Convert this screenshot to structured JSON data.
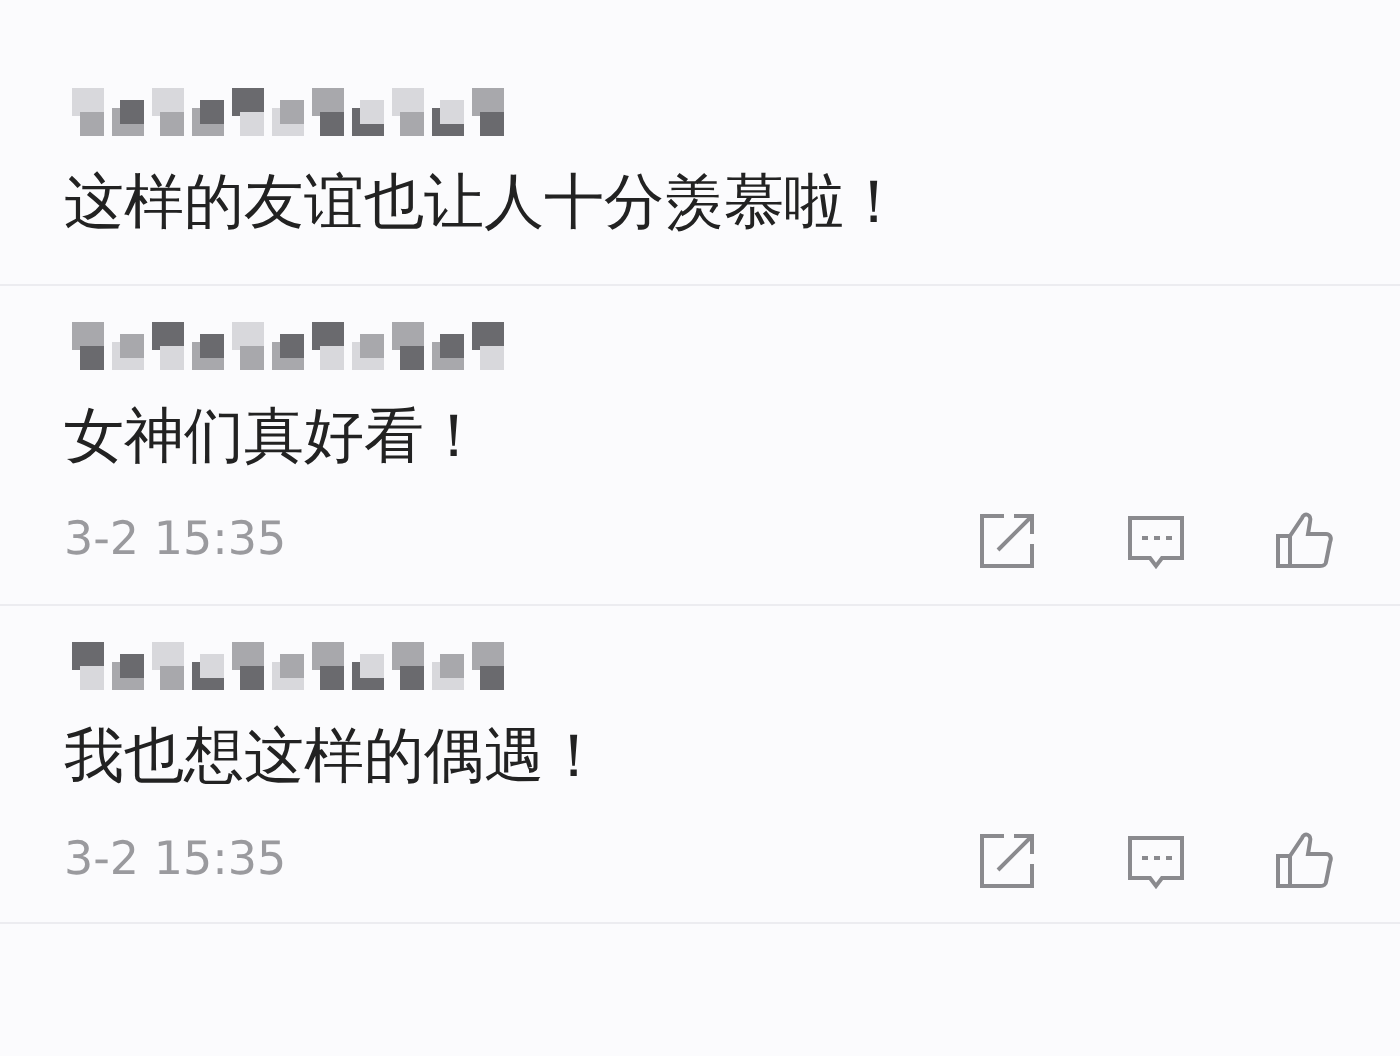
{
  "comments": [
    {
      "text": "这样的友谊也让人十分羡慕啦！"
    },
    {
      "text": "女神们真好看！",
      "time": "3-2 15:35"
    },
    {
      "text": "我也想这样的偶遇！",
      "time": "3-2 15:35"
    }
  ]
}
